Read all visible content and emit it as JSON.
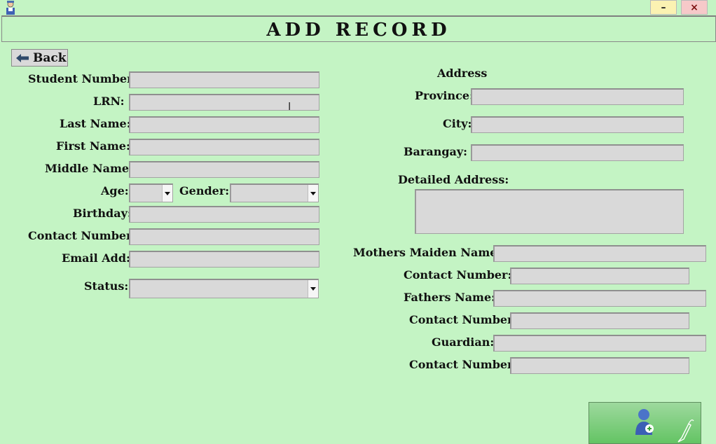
{
  "window": {
    "minimize_glyph": "–",
    "close_glyph": "×",
    "app_icon": "student-app-icon"
  },
  "header": {
    "title": "ADD RECORD"
  },
  "nav": {
    "back_label": "Back",
    "back_icon": "arrow-left-icon"
  },
  "student": {
    "student_number_label": "Student Number:",
    "lrn_label": "LRN:",
    "last_name_label": "Last Name:",
    "first_name_label": "First Name:",
    "middle_name_label": "Middle Name:",
    "age_label": "Age:",
    "gender_label": "Gender:",
    "birthday_label": "Birthday:",
    "contact_number_label": "Contact Number:",
    "email_label": "Email Add:",
    "status_label": "Status:"
  },
  "address": {
    "section_label": "Address",
    "province_label": "Province:",
    "city_label": "City:",
    "barangay_label": "Barangay:",
    "detailed_label": "Detailed Address:"
  },
  "guardians": {
    "mother_label": "Mothers Maiden Name:",
    "mother_contact_label": "Contact Number:",
    "father_label": "Fathers Name:",
    "father_contact_label": "Contact Number:",
    "guardian_label": "Guardian:",
    "guardian_contact_label": "Contact Number:"
  },
  "actions": {
    "save_icon": "add-user-icon"
  },
  "colors": {
    "background": "#c4f4c4",
    "field": "#d9d9d9",
    "save_button": "#7fcf7f"
  }
}
